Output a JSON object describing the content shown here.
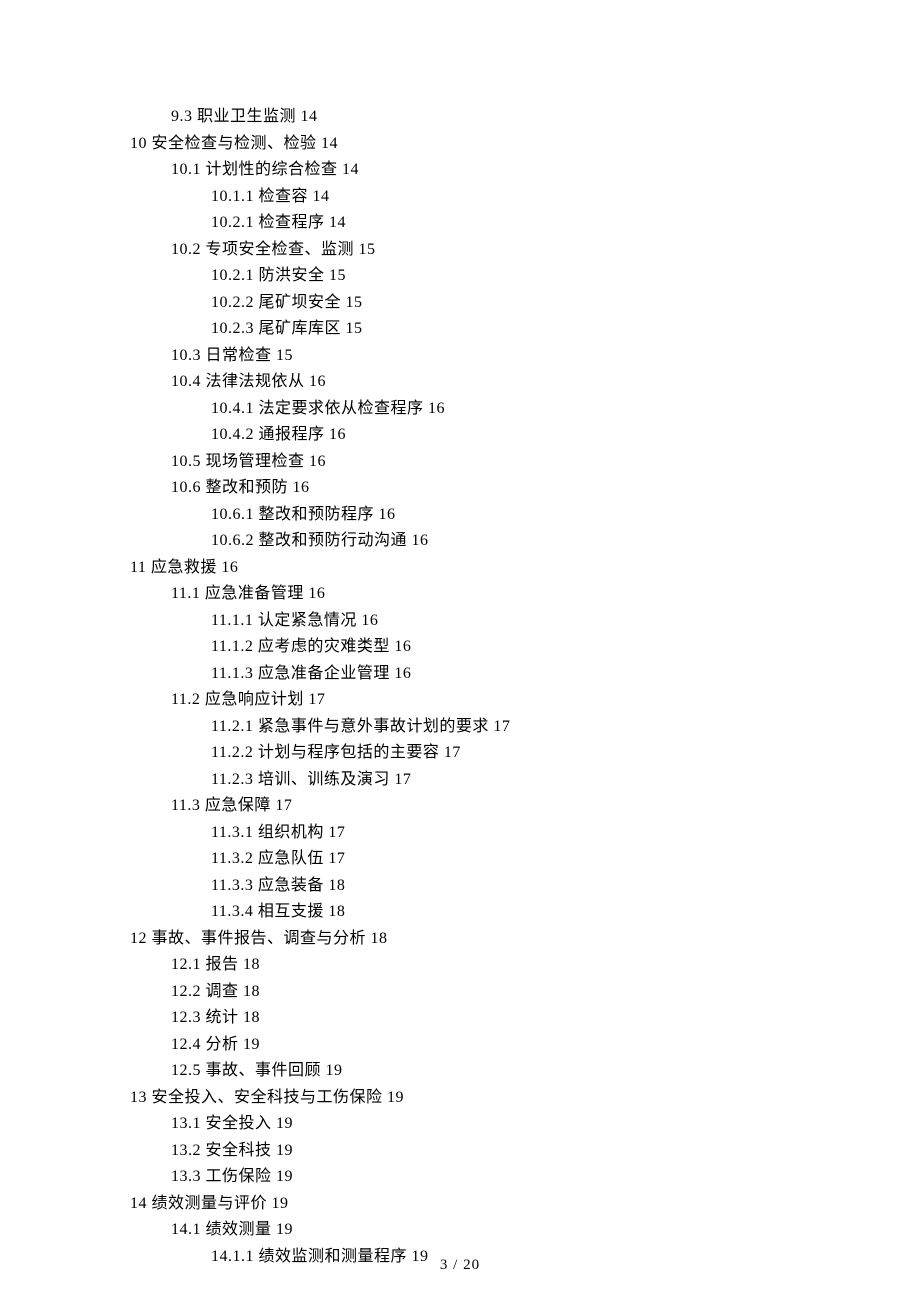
{
  "toc": [
    {
      "lvl": 1,
      "num": "9.3",
      "title": "职业卫生监测",
      "page": "14"
    },
    {
      "lvl": 0,
      "num": "10",
      "title": "安全检查与检测、检验",
      "page": "14"
    },
    {
      "lvl": 1,
      "num": "10.1",
      "title": "计划性的综合检查",
      "page": "14"
    },
    {
      "lvl": 2,
      "num": "10.1.1",
      "title": "检查容",
      "page": "14"
    },
    {
      "lvl": 2,
      "num": "10.2.1",
      "title": "检查程序",
      "page": "14"
    },
    {
      "lvl": 1,
      "num": "10.2",
      "title": "专项安全检查、监测",
      "page": "15"
    },
    {
      "lvl": 2,
      "num": "10.2.1",
      "title": "防洪安全",
      "page": "15"
    },
    {
      "lvl": 2,
      "num": "10.2.2",
      "title": "尾矿坝安全",
      "page": "15"
    },
    {
      "lvl": 2,
      "num": "10.2.3",
      "title": "尾矿库库区",
      "page": "15"
    },
    {
      "lvl": 1,
      "num": "10.3",
      "title": "日常检查",
      "page": "15"
    },
    {
      "lvl": 1,
      "num": "10.4",
      "title": "法律法规依从",
      "page": "16"
    },
    {
      "lvl": 2,
      "num": "10.4.1",
      "title": "法定要求依从检查程序",
      "page": "16"
    },
    {
      "lvl": 2,
      "num": "10.4.2",
      "title": "通报程序",
      "page": "16"
    },
    {
      "lvl": 1,
      "num": "10.5",
      "title": "现场管理检查",
      "page": "16"
    },
    {
      "lvl": 1,
      "num": "10.6",
      "title": "整改和预防",
      "page": "16"
    },
    {
      "lvl": 2,
      "num": "10.6.1",
      "title": "整改和预防程序",
      "page": "16"
    },
    {
      "lvl": 2,
      "num": "10.6.2",
      "title": "整改和预防行动沟通",
      "page": "16"
    },
    {
      "lvl": 0,
      "num": "11",
      "title": "应急救援",
      "page": "16"
    },
    {
      "lvl": 1,
      "num": "11.1",
      "title": "应急准备管理",
      "page": "16"
    },
    {
      "lvl": 2,
      "num": "11.1.1",
      "title": "认定紧急情况",
      "page": "16"
    },
    {
      "lvl": 2,
      "num": "11.1.2",
      "title": "应考虑的灾难类型",
      "page": "16"
    },
    {
      "lvl": 2,
      "num": "11.1.3",
      "title": "应急准备企业管理",
      "page": "16"
    },
    {
      "lvl": 1,
      "num": "11.2",
      "title": "应急响应计划",
      "page": "17"
    },
    {
      "lvl": 2,
      "num": "11.2.1",
      "title": "紧急事件与意外事故计划的要求",
      "page": "17"
    },
    {
      "lvl": 2,
      "num": "11.2.2",
      "title": "计划与程序包括的主要容",
      "page": "17"
    },
    {
      "lvl": 2,
      "num": "11.2.3",
      "title": "培训、训练及演习",
      "page": "17"
    },
    {
      "lvl": 1,
      "num": "11.3",
      "title": "应急保障",
      "page": "17"
    },
    {
      "lvl": 2,
      "num": "11.3.1",
      "title": "组织机构",
      "page": "17"
    },
    {
      "lvl": 2,
      "num": "11.3.2",
      "title": "应急队伍",
      "page": "17"
    },
    {
      "lvl": 2,
      "num": "11.3.3",
      "title": "应急装备",
      "page": "18"
    },
    {
      "lvl": 2,
      "num": "11.3.4",
      "title": "相互支援",
      "page": "18"
    },
    {
      "lvl": 0,
      "num": "12",
      "title": "事故、事件报告、调查与分析",
      "page": "18"
    },
    {
      "lvl": 1,
      "num": "12.1",
      "title": "报告",
      "page": "18"
    },
    {
      "lvl": 1,
      "num": "12.2",
      "title": "调查",
      "page": "18"
    },
    {
      "lvl": 1,
      "num": "12.3",
      "title": "统计",
      "page": "18"
    },
    {
      "lvl": 1,
      "num": "12.4",
      "title": "分析",
      "page": "19"
    },
    {
      "lvl": 1,
      "num": "12.5",
      "title": "事故、事件回顾",
      "page": "19"
    },
    {
      "lvl": 0,
      "num": "13",
      "title": "安全投入、安全科技与工伤保险",
      "page": "19"
    },
    {
      "lvl": 1,
      "num": "13.1",
      "title": "安全投入",
      "page": "19"
    },
    {
      "lvl": 1,
      "num": "13.2",
      "title": "安全科技",
      "page": "19"
    },
    {
      "lvl": 1,
      "num": "13.3",
      "title": "工伤保险",
      "page": "19"
    },
    {
      "lvl": 0,
      "num": "14",
      "title": "绩效测量与评价",
      "page": "19"
    },
    {
      "lvl": 1,
      "num": "14.1",
      "title": "绩效测量",
      "page": "19"
    },
    {
      "lvl": 2,
      "num": "14.1.1",
      "title": "绩效监测和测量程序",
      "page": "19"
    }
  ],
  "footer": {
    "current": "3",
    "sep": " / ",
    "total": "20"
  }
}
